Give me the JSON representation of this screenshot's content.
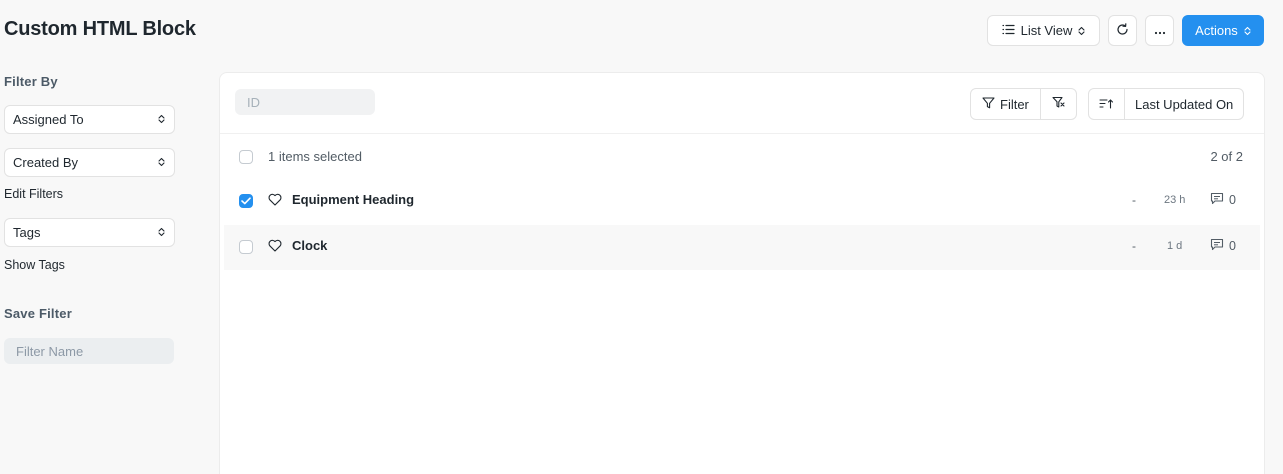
{
  "page": {
    "title": "Custom HTML Block"
  },
  "toolbar": {
    "list_view_label": "List View",
    "actions_label": "Actions"
  },
  "sidebar": {
    "filter_by_label": "Filter By",
    "assigned_to_label": "Assigned To",
    "created_by_label": "Created By",
    "edit_filters_label": "Edit Filters",
    "tags_label": "Tags",
    "show_tags_label": "Show Tags",
    "save_filter_label": "Save Filter",
    "filter_name_placeholder": "Filter Name"
  },
  "list": {
    "id_placeholder": "ID",
    "filter_label": "Filter",
    "sort_label": "Last Updated On",
    "selected_text": "1 items selected",
    "count_text": "2 of 2",
    "rows": [
      {
        "title": "Equipment Heading",
        "status": "-",
        "time": "23 h",
        "comments": "0",
        "checked": true
      },
      {
        "title": "Clock",
        "status": "-",
        "time": "1 d",
        "comments": "0",
        "checked": false
      }
    ]
  },
  "colors": {
    "primary": "#2490ef",
    "background": "#f8f8f8"
  },
  "icons": {
    "list": "list-icon",
    "chevrons": "chevron-updown-icon",
    "refresh": "refresh-icon",
    "more": "ellipsis-icon",
    "filter": "filter-icon",
    "filter_x": "filter-x-icon",
    "sort": "sort-ascending-icon",
    "heart": "heart-icon",
    "comment": "comment-icon",
    "check": "check-icon"
  }
}
